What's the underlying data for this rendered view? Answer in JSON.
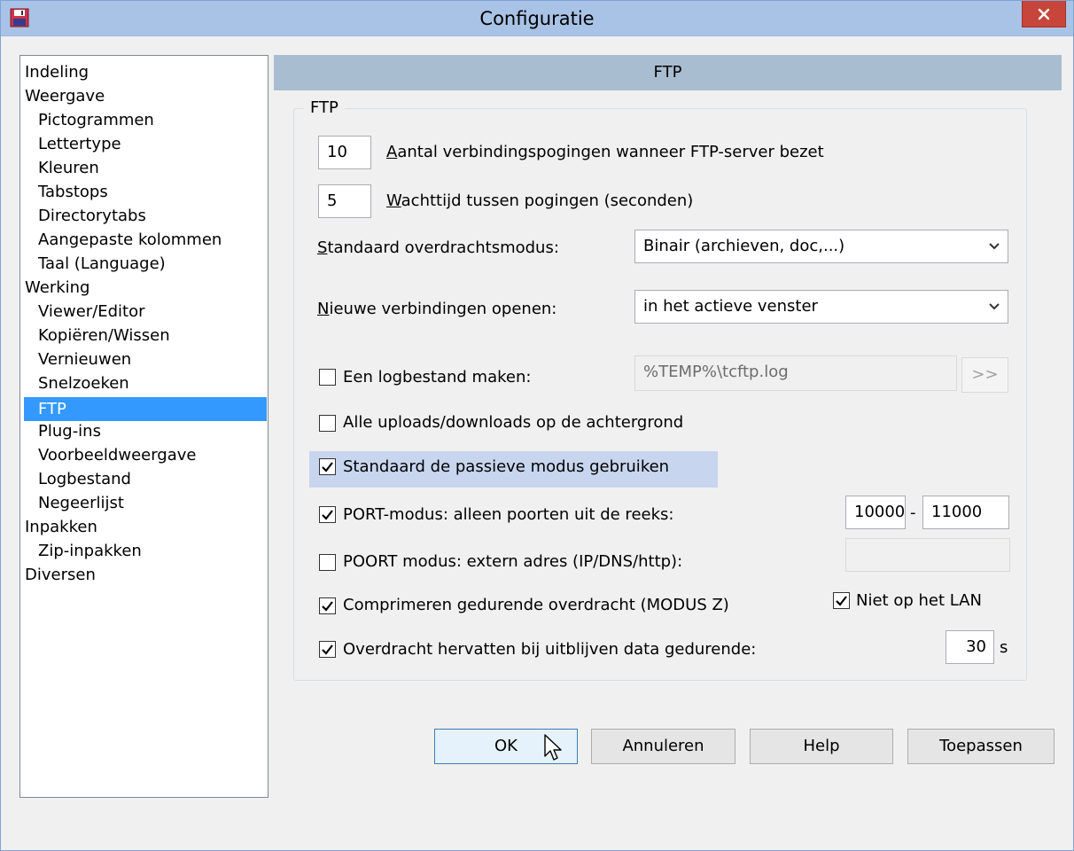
{
  "window": {
    "title": "Configuratie",
    "close_label": "×"
  },
  "tree": {
    "items": [
      {
        "label": "Indeling"
      },
      {
        "label": "Weergave"
      },
      {
        "label": "Pictogrammen"
      },
      {
        "label": "Lettertype"
      },
      {
        "label": "Kleuren"
      },
      {
        "label": "Tabstops"
      },
      {
        "label": "Directorytabs"
      },
      {
        "label": "Aangepaste kolommen"
      },
      {
        "label": "Taal (Language)"
      },
      {
        "label": "Werking"
      },
      {
        "label": "Viewer/Editor"
      },
      {
        "label": "Kopiëren/Wissen"
      },
      {
        "label": "Vernieuwen"
      },
      {
        "label": "Snelzoeken"
      },
      {
        "label": "FTP"
      },
      {
        "label": "Plug-ins"
      },
      {
        "label": "Voorbeeldweergave"
      },
      {
        "label": "Logbestand"
      },
      {
        "label": "Negeerlijst"
      },
      {
        "label": "Inpakken"
      },
      {
        "label": "Zip-inpakken"
      },
      {
        "label": "Diversen"
      }
    ],
    "selected": "FTP"
  },
  "section": {
    "header": "FTP",
    "group_title": "FTP"
  },
  "ftp": {
    "retries_value": "10",
    "retries_label_key": "A",
    "retries_label_rest": "antal verbindingspogingen wanneer FTP-server bezet",
    "wait_value": "5",
    "wait_label_key": "W",
    "wait_label_rest": "achttijd tussen pogingen (seconden)",
    "transfer_mode_label_key": "S",
    "transfer_mode_label_rest": "tandaard overdrachtsmodus:",
    "transfer_mode_value": "Binair (archieven, doc,...)",
    "new_conn_label_key": "N",
    "new_conn_label_rest": "ieuwe verbindingen openen:",
    "new_conn_value": "in het actieve venster",
    "logfile_label": "Een logbestand maken:",
    "logfile_checked": false,
    "logfile_path": "%TEMP%\\tcftp.log",
    "logfile_browse": ">>",
    "background_label": "Alle uploads/downloads op de achtergrond",
    "background_checked": false,
    "passive_label": "Standaard de passieve modus gebruiken",
    "passive_checked": true,
    "port_label": "PORT-modus: alleen poorten uit de reeks:",
    "port_checked": true,
    "port_from": "10000",
    "port_dash": "-",
    "port_to": "11000",
    "external_label": "POORT modus: extern adres (IP/DNS/http):",
    "external_checked": false,
    "external_value": "",
    "compress_label": "Comprimeren gedurende overdracht (MODUS Z)",
    "compress_checked": true,
    "not_lan_label": "Niet op het LAN",
    "not_lan_checked": true,
    "resume_label": "Overdracht hervatten bij uitblijven data gedurende:",
    "resume_checked": true,
    "resume_value": "30",
    "resume_unit": "s"
  },
  "buttons": {
    "ok": "OK",
    "cancel": "Annuleren",
    "help": "Help",
    "apply": "Toepassen"
  },
  "colors": {
    "title_bar": "#a9c3e6",
    "close_button": "#c7453a",
    "selection": "#3399ff",
    "section_header": "#a9bdd0",
    "highlight_row": "#c8d5ee"
  }
}
